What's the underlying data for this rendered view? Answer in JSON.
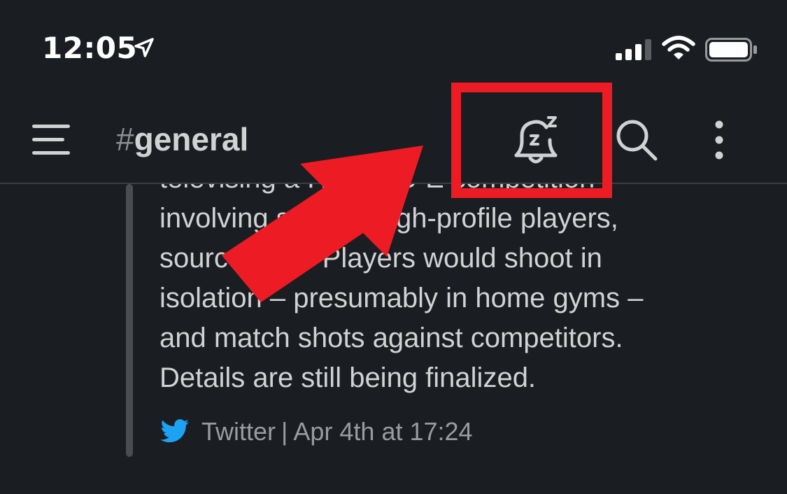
{
  "status_bar": {
    "time": "12:05",
    "icons": [
      "location-arrow-icon",
      "cellular-signal-icon",
      "wifi-icon",
      "battery-icon"
    ]
  },
  "header": {
    "menu_icon": "hamburger-menu-icon",
    "channel_hash": "#",
    "channel_name": "general",
    "actions": [
      "snooze-notifications-icon",
      "search-icon",
      "more-options-icon"
    ]
  },
  "message": {
    "quote_lines": [
      "televising a H-O-R-S-E competition",
      "involving several high-profile players,",
      "sources say. Players would shoot in",
      "isolation – presumably in home gyms –",
      "and match shots against competitors.",
      "Details are still being finalized."
    ],
    "source": "Twitter",
    "separator": "|",
    "timestamp": "Apr 4th at 17:24"
  },
  "colors": {
    "background": "#1a1d21",
    "text": "#d1d2d3",
    "muted_text": "#9a9b9d",
    "annotation_red": "#ed1c24",
    "twitter_blue": "#1da1f2"
  }
}
